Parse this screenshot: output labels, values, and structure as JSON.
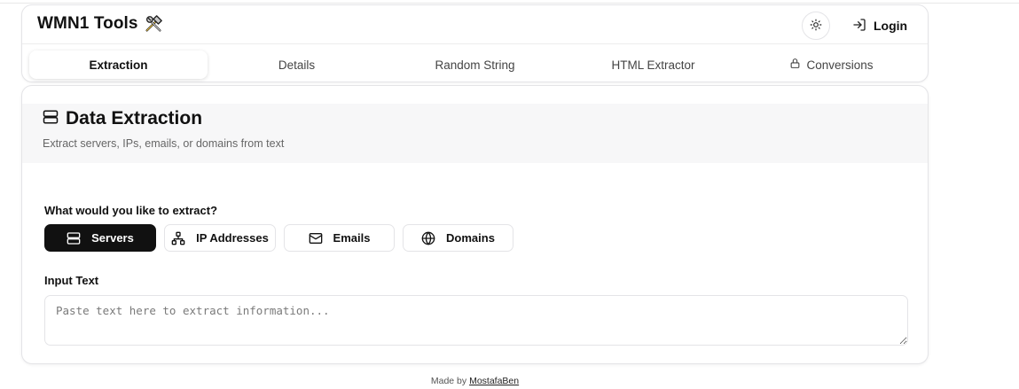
{
  "app": {
    "title": "WMN1 Tools",
    "logo_icon": "hammer-wrench-icon",
    "theme_icon": "sun-icon",
    "login_icon": "log-in-icon",
    "login_label": "Login"
  },
  "tabs": [
    {
      "label": "Extraction",
      "active": true
    },
    {
      "label": "Details",
      "active": false
    },
    {
      "label": "Random String",
      "active": false
    },
    {
      "label": "HTML Extractor",
      "active": false
    },
    {
      "label": "Conversions",
      "active": false,
      "icon": "lock-icon"
    }
  ],
  "card": {
    "title": "Data Extraction",
    "title_icon": "server-icon",
    "subtitle": "Extract servers, IPs, emails, or domains from text"
  },
  "extract": {
    "question": "What would you like to extract?",
    "options": [
      {
        "label": "Servers",
        "icon": "server-icon",
        "selected": true
      },
      {
        "label": "IP Addresses",
        "icon": "network-icon",
        "selected": false
      },
      {
        "label": "Emails",
        "icon": "mail-icon",
        "selected": false
      },
      {
        "label": "Domains",
        "icon": "globe-icon",
        "selected": false
      }
    ]
  },
  "input": {
    "label": "Input Text",
    "value": "",
    "placeholder": "Paste text here to extract information..."
  },
  "footer": {
    "prefix": "Made by",
    "author": "MostafaBen"
  },
  "colors": {
    "accent": "#111111",
    "border": "#e4e4e7",
    "muted_bg": "#f7f7f8"
  }
}
